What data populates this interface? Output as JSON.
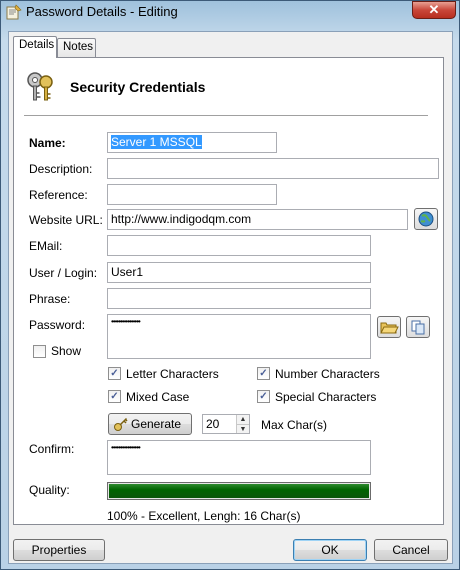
{
  "window": {
    "title": "Password Details - Editing",
    "close_glyph": "✕"
  },
  "tabs": [
    {
      "label": "Details",
      "active": true
    },
    {
      "label": "Notes",
      "active": false
    }
  ],
  "header": {
    "title": "Security Credentials",
    "icon": "keys-icon"
  },
  "form": {
    "name_label": "Name:",
    "name_value": "Server 1 MSSQL",
    "description_label": "Description:",
    "description_value": "",
    "reference_label": "Reference:",
    "reference_value": "",
    "url_label": "Website URL:",
    "url_value": "http://www.indigodqm.com",
    "url_button_icon": "globe-icon",
    "email_label": "EMail:",
    "email_value": "",
    "user_label": "User / Login:",
    "user_value": "User1",
    "phrase_label": "Phrase:",
    "phrase_value": "",
    "password_label": "Password:",
    "password_value": "••••••••••••••••",
    "open_button_icon": "folder-open-icon",
    "copy_button_icon": "copy-icon",
    "show_label": "Show",
    "show_checked": false,
    "options": {
      "letter": {
        "label": "Letter Characters",
        "checked": true
      },
      "number": {
        "label": "Number Characters",
        "checked": true
      },
      "mixed": {
        "label": "Mixed Case",
        "checked": true
      },
      "special": {
        "label": "Special Characters",
        "checked": true
      }
    },
    "generate_label": "Generate",
    "generate_icon": "key-icon",
    "max_chars_value": "20",
    "max_chars_label": "Max Char(s)",
    "confirm_label": "Confirm:",
    "confirm_value": "••••••••••••••••",
    "quality_label": "Quality:",
    "quality_fraction": 1.0,
    "quality_text": "100% - Excellent, Lengh: 16 Char(s)"
  },
  "footer": {
    "properties_label": "Properties",
    "ok_label": "OK",
    "cancel_label": "Cancel"
  },
  "colors": {
    "quality_fill": "#006400",
    "selection": "#3399ff"
  }
}
